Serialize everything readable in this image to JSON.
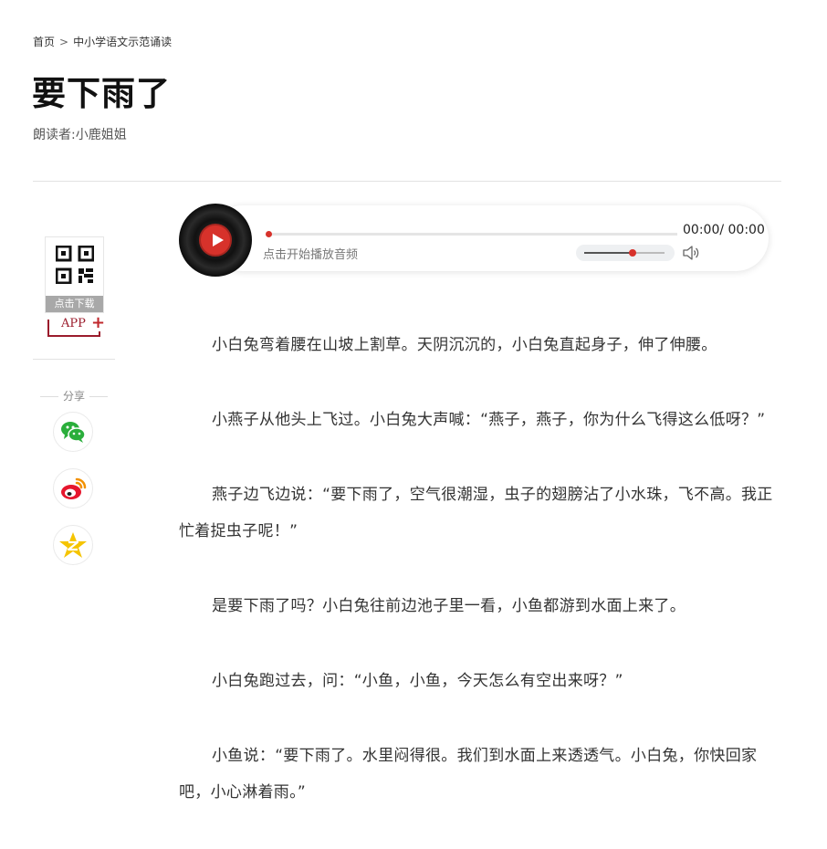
{
  "breadcrumb": {
    "home": "首页",
    "separator": ">",
    "category": "中小学语文示范诵读"
  },
  "page_title": "要下雨了",
  "reader": "朗读者:小鹿姐姐",
  "app_download": {
    "qr_label": "点击下载",
    "app_label": "APP",
    "plus": "+"
  },
  "share": {
    "label": "分享",
    "icons": [
      "wechat-icon",
      "weibo-icon",
      "qzone-icon"
    ]
  },
  "player": {
    "time": "00:00/ 00:00",
    "hint": "点击开始播放音频",
    "progress": 0,
    "volume": 0.6,
    "accent_color": "#d7322b"
  },
  "article": {
    "paragraphs": [
      "小白兔弯着腰在山坡上割草。天阴沉沉的，小白兔直起身子，伸了伸腰。",
      "小燕子从他头上飞过。小白兔大声喊：“燕子，燕子，你为什么飞得这么低呀？”",
      "燕子边飞边说：“要下雨了，空气很潮湿，虫子的翅膀沾了小水珠，飞不高。我正忙着捉虫子呢！”",
      "是要下雨了吗？小白兔往前边池子里一看，小鱼都游到水面上来了。",
      "小白兔跑过去，问：“小鱼，小鱼，今天怎么有空出来呀？”",
      "小鱼说：“要下雨了。水里闷得很。我们到水面上来透透气。小白兔，你快回家吧，小心淋着雨。”"
    ]
  }
}
